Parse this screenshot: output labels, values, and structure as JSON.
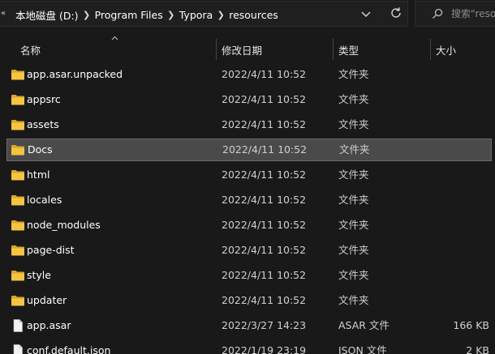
{
  "address_bar": {
    "breadcrumbs": [
      "本地磁盘 (D:)",
      "Program Files",
      "Typora",
      "resources"
    ]
  },
  "search": {
    "placeholder": "搜索\"resources\""
  },
  "columns": {
    "name": "名称",
    "date": "修改日期",
    "type": "类型",
    "size": "大小"
  },
  "files": [
    {
      "name": "app.asar.unpacked",
      "date": "2022/4/11 10:52",
      "type": "文件夹",
      "size": "",
      "icon": "folder-icon"
    },
    {
      "name": "appsrc",
      "date": "2022/4/11 10:52",
      "type": "文件夹",
      "size": "",
      "icon": "folder-icon"
    },
    {
      "name": "assets",
      "date": "2022/4/11 10:52",
      "type": "文件夹",
      "size": "",
      "icon": "folder-icon"
    },
    {
      "name": "Docs",
      "date": "2022/4/11 10:52",
      "type": "文件夹",
      "size": "",
      "icon": "folder-icon"
    },
    {
      "name": "html",
      "date": "2022/4/11 10:52",
      "type": "文件夹",
      "size": "",
      "icon": "folder-icon"
    },
    {
      "name": "locales",
      "date": "2022/4/11 10:52",
      "type": "文件夹",
      "size": "",
      "icon": "folder-icon"
    },
    {
      "name": "node_modules",
      "date": "2022/4/11 10:52",
      "type": "文件夹",
      "size": "",
      "icon": "folder-icon"
    },
    {
      "name": "page-dist",
      "date": "2022/4/11 10:52",
      "type": "文件夹",
      "size": "",
      "icon": "folder-icon"
    },
    {
      "name": "style",
      "date": "2022/4/11 10:52",
      "type": "文件夹",
      "size": "",
      "icon": "folder-icon"
    },
    {
      "name": "updater",
      "date": "2022/4/11 10:52",
      "type": "文件夹",
      "size": "",
      "icon": "folder-icon"
    },
    {
      "name": "app.asar",
      "date": "2022/3/27 14:23",
      "type": "ASAR 文件",
      "size": "166 KB",
      "icon": "file-icon"
    },
    {
      "name": "conf.default.json",
      "date": "2022/1/19 23:19",
      "type": "JSON 文件",
      "size": "2 KB",
      "icon": "file-icon"
    }
  ],
  "selected_file": "Docs",
  "colors": {
    "background": "#191919",
    "selection": "#4a4a4a",
    "selection_border": "#6b6b6b",
    "folder_yellow": "#f5c443"
  }
}
